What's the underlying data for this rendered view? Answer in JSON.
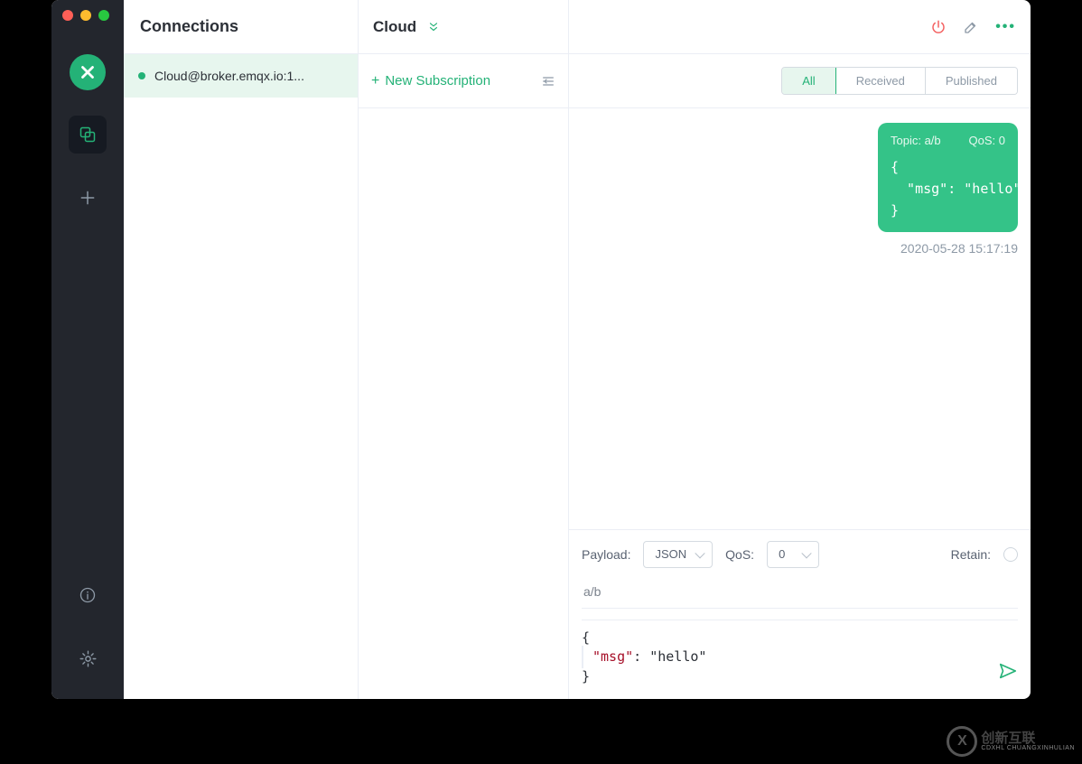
{
  "sidebar": {
    "title": "Connections",
    "items": [
      {
        "label": "Cloud@broker.emqx.io:1...",
        "online": true
      }
    ]
  },
  "nav": {
    "logo": "X",
    "buttons": [
      "connections-icon",
      "add-icon"
    ],
    "footer": [
      "info-icon",
      "settings-icon"
    ]
  },
  "header": {
    "connection_name": "Cloud",
    "actions": {
      "power": "⏻",
      "edit": "✎",
      "more": "•••"
    }
  },
  "subscriptions": {
    "new_label": "New Subscription"
  },
  "filter": {
    "tabs": [
      "All",
      "Received",
      "Published"
    ],
    "active": "All"
  },
  "messages": [
    {
      "direction": "out",
      "topic_label": "Topic: a/b",
      "qos_label": "QoS: 0",
      "body": "{\n  \"msg\": \"hello\"\n}",
      "time": "2020-05-28 15:17:19"
    }
  ],
  "publish": {
    "payload_label": "Payload:",
    "payload_format": "JSON",
    "qos_label": "QoS:",
    "qos_value": "0",
    "retain_label": "Retain:",
    "topic": "a/b",
    "body_key": "\"msg\"",
    "body_val": "\"hello\""
  },
  "watermark": {
    "logo": "X",
    "name": "创新互联",
    "sub": "CDXHL CHUANGXINHULIAN"
  }
}
